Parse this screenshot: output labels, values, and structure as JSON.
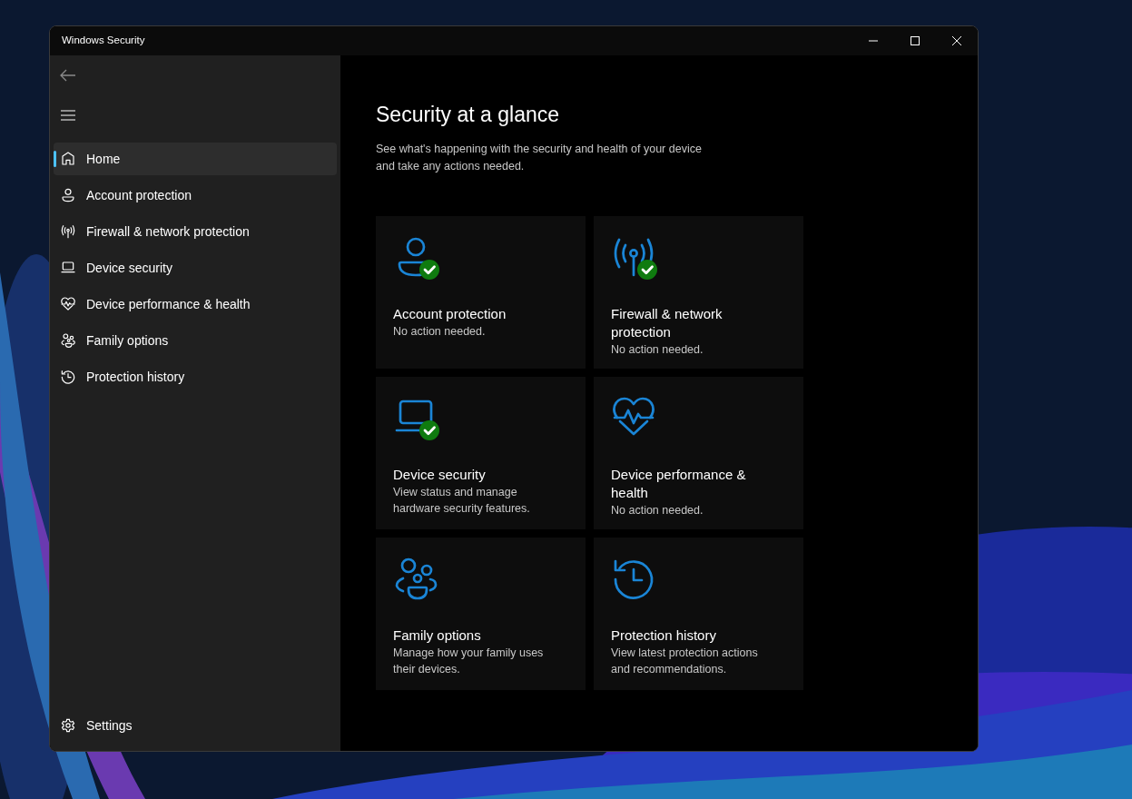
{
  "window": {
    "title": "Windows Security"
  },
  "sidebar": {
    "items": [
      {
        "label": "Home",
        "kind": "home",
        "selected": true
      },
      {
        "label": "Account protection",
        "kind": "person",
        "selected": false
      },
      {
        "label": "Firewall & network protection",
        "kind": "antenna",
        "selected": false
      },
      {
        "label": "Device security",
        "kind": "laptop",
        "selected": false
      },
      {
        "label": "Device performance & health",
        "kind": "heart",
        "selected": false
      },
      {
        "label": "Family options",
        "kind": "family",
        "selected": false
      },
      {
        "label": "Protection history",
        "kind": "history",
        "selected": false
      }
    ],
    "settings": {
      "label": "Settings"
    }
  },
  "page": {
    "heading": "Security at a glance",
    "description_lines": [
      "See what's happening with the security and health of your device",
      "and take any actions needed."
    ],
    "tiles": [
      {
        "kind": "person",
        "ok": true,
        "title": "Account protection",
        "status": "No action needed."
      },
      {
        "kind": "antenna",
        "ok": true,
        "title": "Firewall & network protection",
        "status": "No action needed."
      },
      {
        "kind": "laptop",
        "ok": true,
        "title": "Device security",
        "status": "View status and manage hardware security features."
      },
      {
        "kind": "heart",
        "ok": false,
        "title": "Device performance & health",
        "status": "No action needed."
      },
      {
        "kind": "family",
        "ok": false,
        "title": "Family options",
        "status": "Manage how your family uses their devices."
      },
      {
        "kind": "history",
        "ok": false,
        "title": "Protection history",
        "status": "View latest protection actions and recommendations."
      }
    ]
  }
}
